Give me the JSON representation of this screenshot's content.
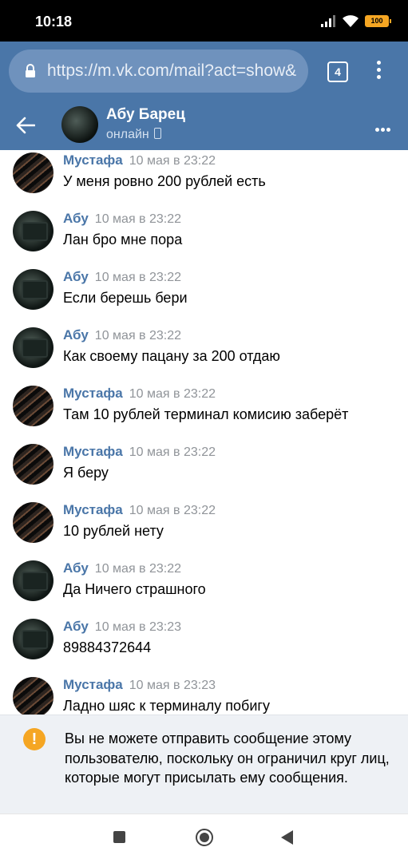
{
  "status_bar": {
    "time": "10:18",
    "battery": "100"
  },
  "browser": {
    "url": "https://m.vk.com/mail?act=show&",
    "tab_count": "4"
  },
  "chat_header": {
    "name": "Абу Барец",
    "status": "онлайн"
  },
  "messages": [
    {
      "author": "Мустафа",
      "date": "10 мая в 23:22",
      "text": "У меня ровно 200 рублей есть"
    },
    {
      "author": "Абу",
      "date": "10 мая в 23:22",
      "text": "Лан бро мне пора"
    },
    {
      "author": "Абу",
      "date": "10 мая в 23:22",
      "text": "Если берешь бери"
    },
    {
      "author": "Абу",
      "date": "10 мая в 23:22",
      "text": "Как своему пацану за 200 отдаю"
    },
    {
      "author": "Мустафа",
      "date": "10 мая в 23:22",
      "text": "Там 10 рублей терминал комисию заберёт"
    },
    {
      "author": "Мустафа",
      "date": "10 мая в 23:22",
      "text": "Я беру"
    },
    {
      "author": "Мустафа",
      "date": "10 мая в 23:22",
      "text": "10 рублей нету"
    },
    {
      "author": "Абу",
      "date": "10 мая в 23:22",
      "text": "Да Ничего страшного"
    },
    {
      "author": "Абу",
      "date": "10 мая в 23:23",
      "text": "89884372644"
    },
    {
      "author": "Мустафа",
      "date": "10 мая в 23:23",
      "text": "Ладно шяс к терминалу побигу"
    }
  ],
  "notice": {
    "text": "Вы не можете отправить сообщение этому пользователю, поскольку он ограничил круг лиц, которые могут присылать ему сообщения."
  },
  "colors": {
    "vk_blue": "#4a76a8",
    "warning": "#f5a623",
    "date_gray": "#909499"
  }
}
